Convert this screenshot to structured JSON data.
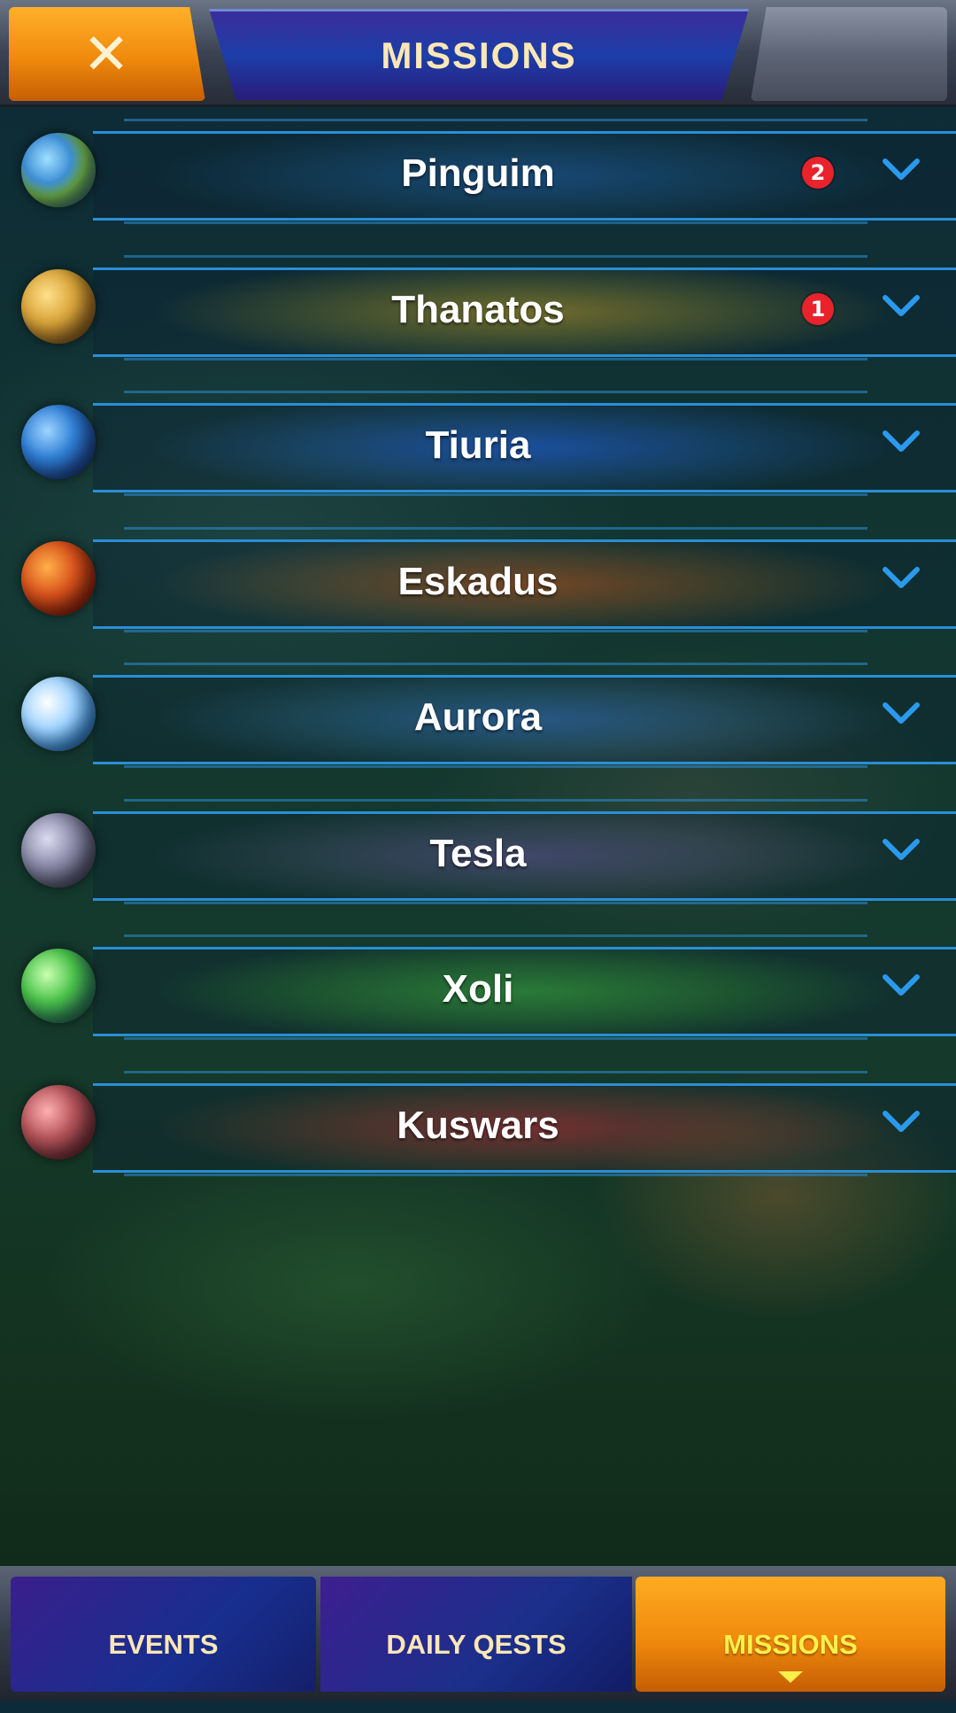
{
  "header": {
    "close_icon": "close-icon",
    "title": "MISSIONS"
  },
  "planets": [
    {
      "name": "Pinguim",
      "badge": "2",
      "icon": "planet-pinguim-icon",
      "tint": "#1a4f86"
    },
    {
      "name": "Thanatos",
      "badge": "1",
      "icon": "planet-thanatos-icon",
      "tint": "#8a7b2a"
    },
    {
      "name": "Tiuria",
      "badge": "",
      "icon": "planet-tiuria-icon",
      "tint": "#1d55b8"
    },
    {
      "name": "Eskadus",
      "badge": "",
      "icon": "planet-eskadus-icon",
      "tint": "#8a4a22"
    },
    {
      "name": "Aurora",
      "badge": "",
      "icon": "planet-aurora-icon",
      "tint": "#2b5f9a"
    },
    {
      "name": "Tesla",
      "badge": "",
      "icon": "planet-tesla-icon",
      "tint": "#4b4a78"
    },
    {
      "name": "Xoli",
      "badge": "",
      "icon": "planet-xoli-icon",
      "tint": "#2f8a3a"
    },
    {
      "name": "Kuswars",
      "badge": "",
      "icon": "planet-kuswars-icon",
      "tint": "#8a2e34"
    }
  ],
  "tabs": [
    {
      "label": "EVENTS"
    },
    {
      "label": "DAILY QESTS"
    },
    {
      "label": "MISSIONS"
    }
  ],
  "colors": {
    "accent_orange": "#f08a0c",
    "accent_blue": "#2a8ed6",
    "badge_red": "#e8232b",
    "title_text": "#fde7b6",
    "active_tab_text": "#fff04a"
  }
}
